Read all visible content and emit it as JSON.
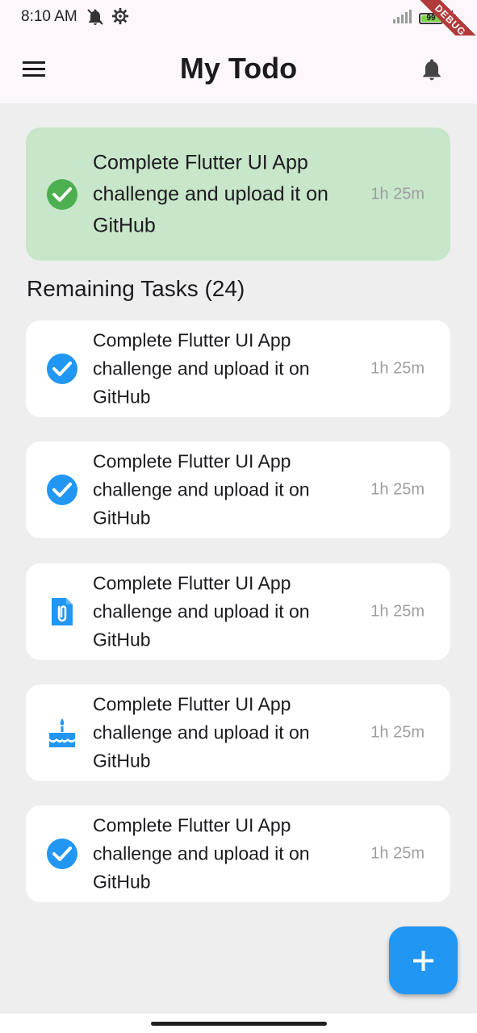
{
  "status_bar": {
    "time": "8:10 AM",
    "battery_level": "99",
    "left_icons": [
      "notifications-off-icon",
      "settings-icon"
    ],
    "right_icons": [
      "signal-icon",
      "battery-icon",
      "charging-bolt-icon"
    ]
  },
  "debug_banner": "DEBUG",
  "app_bar": {
    "title": "My Todo",
    "menu_icon": "menu-icon",
    "bell_icon": "bell-icon"
  },
  "highlight_task": {
    "text": "Complete Flutter UI App challenge and upload it on GitHub",
    "time": "1h 25m",
    "icon": "check-circle-icon",
    "color": "#c8e6c9"
  },
  "remaining": {
    "heading": "Remaining Tasks (24)",
    "tasks": [
      {
        "text": "Complete Flutter UI App challenge and upload it on GitHub",
        "time": "1h 25m",
        "icon": "check-circle-icon"
      },
      {
        "text": "Complete Flutter UI App challenge and upload it on GitHub",
        "time": "1h 25m",
        "icon": "check-circle-icon"
      },
      {
        "text": "Complete Flutter UI App challenge and upload it on GitHub",
        "time": "1h 25m",
        "icon": "attachment-file-icon"
      },
      {
        "text": "Complete Flutter UI App challenge and upload it on GitHub",
        "time": "1h 25m",
        "icon": "cake-icon"
      },
      {
        "text": "Complete Flutter UI App challenge and upload it on GitHub",
        "time": "1h 25m",
        "icon": "check-circle-icon"
      }
    ]
  },
  "fab": {
    "icon": "add-icon",
    "color": "#2196f3"
  },
  "colors": {
    "accent": "#2196f3",
    "highlight_green": "#4caf50",
    "background": "#eeeeee",
    "app_bar": "#fdf7fd"
  }
}
